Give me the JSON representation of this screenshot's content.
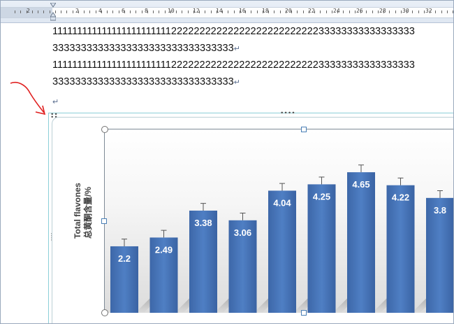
{
  "ruler": {
    "labels": [
      "2",
      "2",
      "4",
      "6",
      "8",
      "10",
      "12",
      "14",
      "16",
      "18",
      "20",
      "22",
      "24",
      "26",
      "28",
      "30",
      "32"
    ]
  },
  "document": {
    "lines": [
      "1111111111111111111111112222222222222222222222222233333333333333333",
      "33333333333333333333333333333333",
      "1111111111111111111111112222222222222222222222222233333333333333333",
      "33333333333333333333333333333333"
    ],
    "paragraph_mark": "↵"
  },
  "annotation": {
    "color": "#e02020"
  },
  "chart_data": {
    "type": "bar",
    "ylabel_line1": "Total flavones",
    "ylabel_line2": "总黄酮含量/%",
    "values": [
      2.2,
      2.49,
      3.38,
      3.06,
      4.04,
      4.25,
      4.65,
      4.22,
      3.8
    ],
    "value_labels": [
      "2.2",
      "2.49",
      "3.38",
      "3.06",
      "4.04",
      "4.25",
      "4.65",
      "4.22",
      "3.8"
    ],
    "error": [
      0.24,
      0.24,
      0.24,
      0.24,
      0.24,
      0.24,
      0.24,
      0.24,
      0.24
    ],
    "bar_color": "#4472c4",
    "label_color": "#ffffff"
  }
}
